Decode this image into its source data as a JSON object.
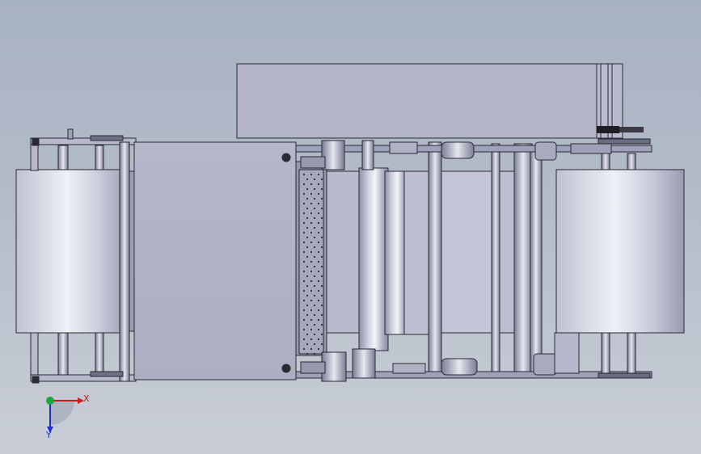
{
  "viewport": {
    "background_top": "#a7b2c1",
    "background_bottom": "#c9ced6"
  },
  "triad": {
    "x_label": "X",
    "y_label": "Y",
    "x_color": "#d11a1a",
    "y_color": "#1a2fd1",
    "z_color": "#1aa83a"
  },
  "model": {
    "body_color": "#b7b8cc",
    "edge_color": "#2a2a33",
    "roll_highlight": "#f2f2f7",
    "roll_shadow": "#6e7088"
  }
}
